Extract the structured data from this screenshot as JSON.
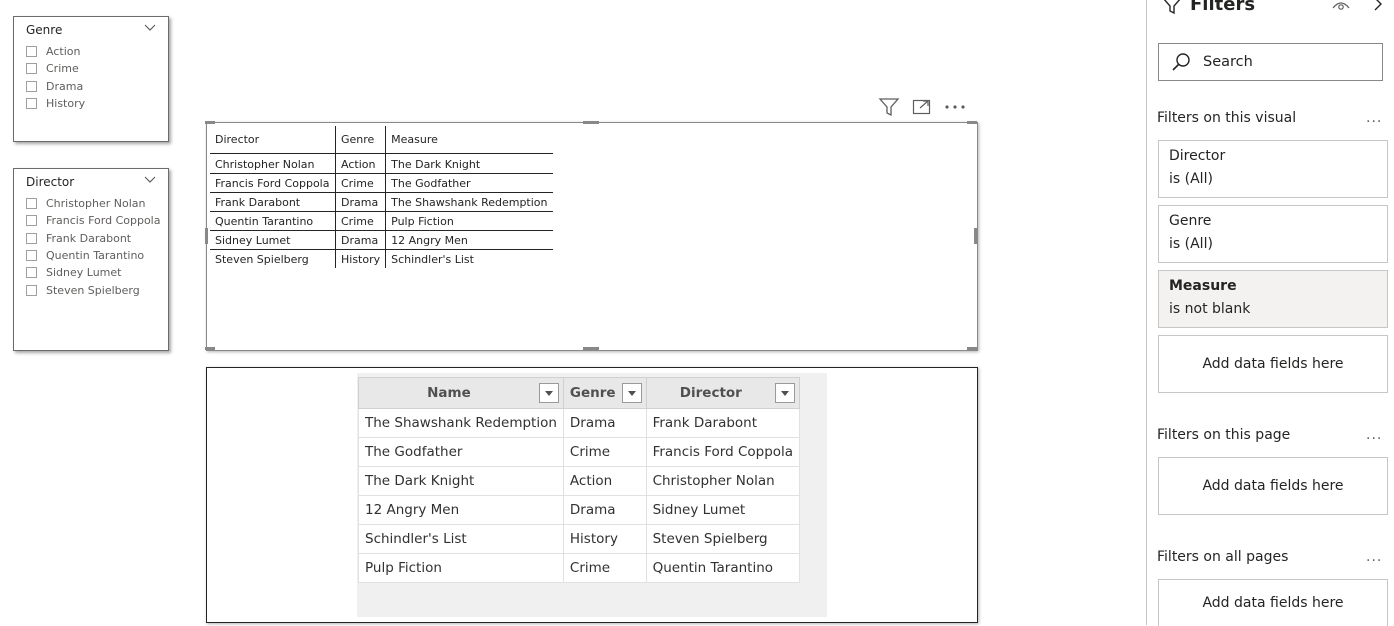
{
  "slicers": [
    {
      "title": "Genre",
      "items": [
        "Action",
        "Crime",
        "Drama",
        "History"
      ]
    },
    {
      "title": "Director",
      "items": [
        "Christopher Nolan",
        "Francis Ford Coppola",
        "Frank Darabont",
        "Quentin Tarantino",
        "Sidney Lumet",
        "Steven Spielberg"
      ]
    }
  ],
  "matrix": {
    "headers": [
      "Director",
      "Genre",
      "Measure"
    ],
    "rows": [
      [
        "Christopher Nolan",
        "Action",
        "The Dark Knight"
      ],
      [
        "Francis Ford Coppola",
        "Crime",
        "The Godfather"
      ],
      [
        "Frank Darabont",
        "Drama",
        "The Shawshank Redemption"
      ],
      [
        "Quentin Tarantino",
        "Crime",
        "Pulp Fiction"
      ],
      [
        "Sidney Lumet",
        "Drama",
        "12 Angry Men"
      ],
      [
        "Steven Spielberg",
        "History",
        "Schindler's List"
      ]
    ]
  },
  "table2": {
    "headers": [
      "Name",
      "Genre",
      "Director"
    ],
    "rows": [
      [
        "The Shawshank Redemption",
        "Drama",
        "Frank Darabont"
      ],
      [
        "The Godfather",
        "Crime",
        "Francis Ford Coppola"
      ],
      [
        "The Dark Knight",
        "Action",
        "Christopher Nolan"
      ],
      [
        "12 Angry Men",
        "Drama",
        "Sidney Lumet"
      ],
      [
        "Schindler's List",
        "History",
        "Steven Spielberg"
      ],
      [
        "Pulp Fiction",
        "Crime",
        "Quentin Tarantino"
      ]
    ]
  },
  "filters": {
    "title": "Filters",
    "search_placeholder": "Search",
    "section_visual": "Filters on this visual",
    "section_page": "Filters on this page",
    "section_all": "Filters on all pages",
    "more": "...",
    "cards": [
      {
        "name": "Director",
        "value": "is (All)"
      },
      {
        "name": "Genre",
        "value": "is (All)"
      },
      {
        "name": "Measure",
        "value": "is not blank"
      }
    ],
    "add_fields": "Add data fields here"
  }
}
